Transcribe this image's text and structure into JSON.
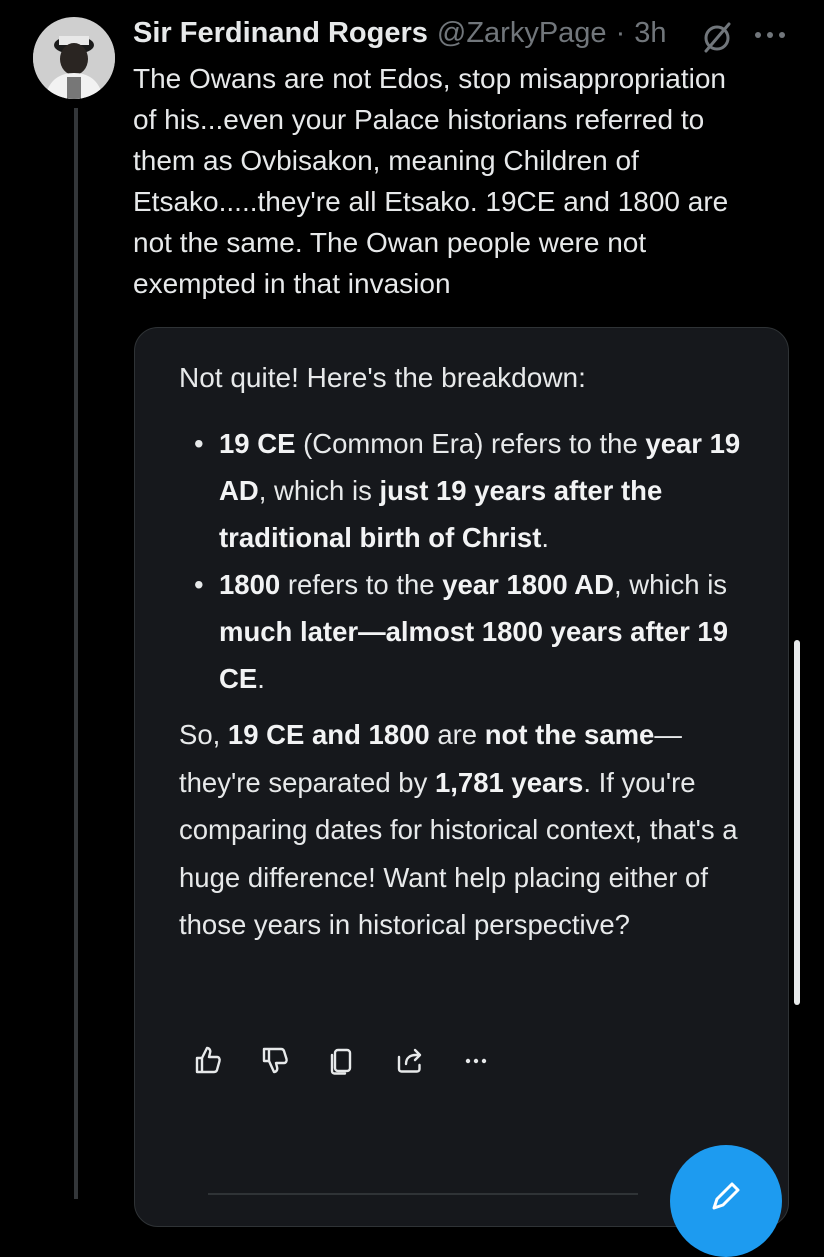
{
  "tweet": {
    "author_name": "Sir Ferdinand Rogers",
    "handle": "@ZarkyPage",
    "separator": "·",
    "time": "3h",
    "text": "The Owans are not Edos, stop misappropriation\nof his...even your Palace historians referred to\nthem as Ovbisakon, meaning Children of\nEtsako.....they're all Etsako. 19CE and 1800 are\nnot the same. The Owan people were not\nexempted in that invasion",
    "icons": {
      "avatar": "profile-photo",
      "grok": "grok-icon",
      "more": "more-options-icon"
    }
  },
  "grok_card": {
    "intro": "Not quite! Here's the breakdown:",
    "bullets": [
      {
        "marker": "•",
        "parts": [
          {
            "text": "19 CE",
            "bold": true
          },
          {
            "text": " (Common Era) refers to the ",
            "bold": false
          },
          {
            "text": "year 19 AD",
            "bold": true
          },
          {
            "text": ", which is ",
            "bold": false
          },
          {
            "text": "just 19 years after the traditional birth of Christ",
            "bold": true
          },
          {
            "text": ".",
            "bold": false
          }
        ]
      },
      {
        "marker": "•",
        "parts": [
          {
            "text": "1800",
            "bold": true
          },
          {
            "text": " refers to the ",
            "bold": false
          },
          {
            "text": "year 1800 AD",
            "bold": true
          },
          {
            "text": ", which is ",
            "bold": false
          },
          {
            "text": "much later—almost 1800 years after 19 CE",
            "bold": true
          },
          {
            "text": ".",
            "bold": false
          }
        ]
      }
    ],
    "summary": [
      {
        "text": "So, ",
        "bold": false
      },
      {
        "text": "19 CE and 1800",
        "bold": true
      },
      {
        "text": " are ",
        "bold": false
      },
      {
        "text": "not the same",
        "bold": true
      },
      {
        "text": "— they're separated by ",
        "bold": false
      },
      {
        "text": "1,781 years",
        "bold": true
      },
      {
        "text": ". If you're comparing dates for historical context, that's a huge difference! Want help placing either of those years in historical perspective?",
        "bold": false
      }
    ],
    "actions": {
      "like": "thumbs-up-icon",
      "dislike": "thumbs-down-icon",
      "copy": "copy-icon",
      "share": "share-icon",
      "more": "more-icon"
    }
  },
  "colors": {
    "background": "#000000",
    "card_background": "#16181c",
    "text": "#e7e9ea",
    "secondary_text": "#71767b",
    "border": "#2f3336",
    "accent": "#1d9bf0"
  }
}
